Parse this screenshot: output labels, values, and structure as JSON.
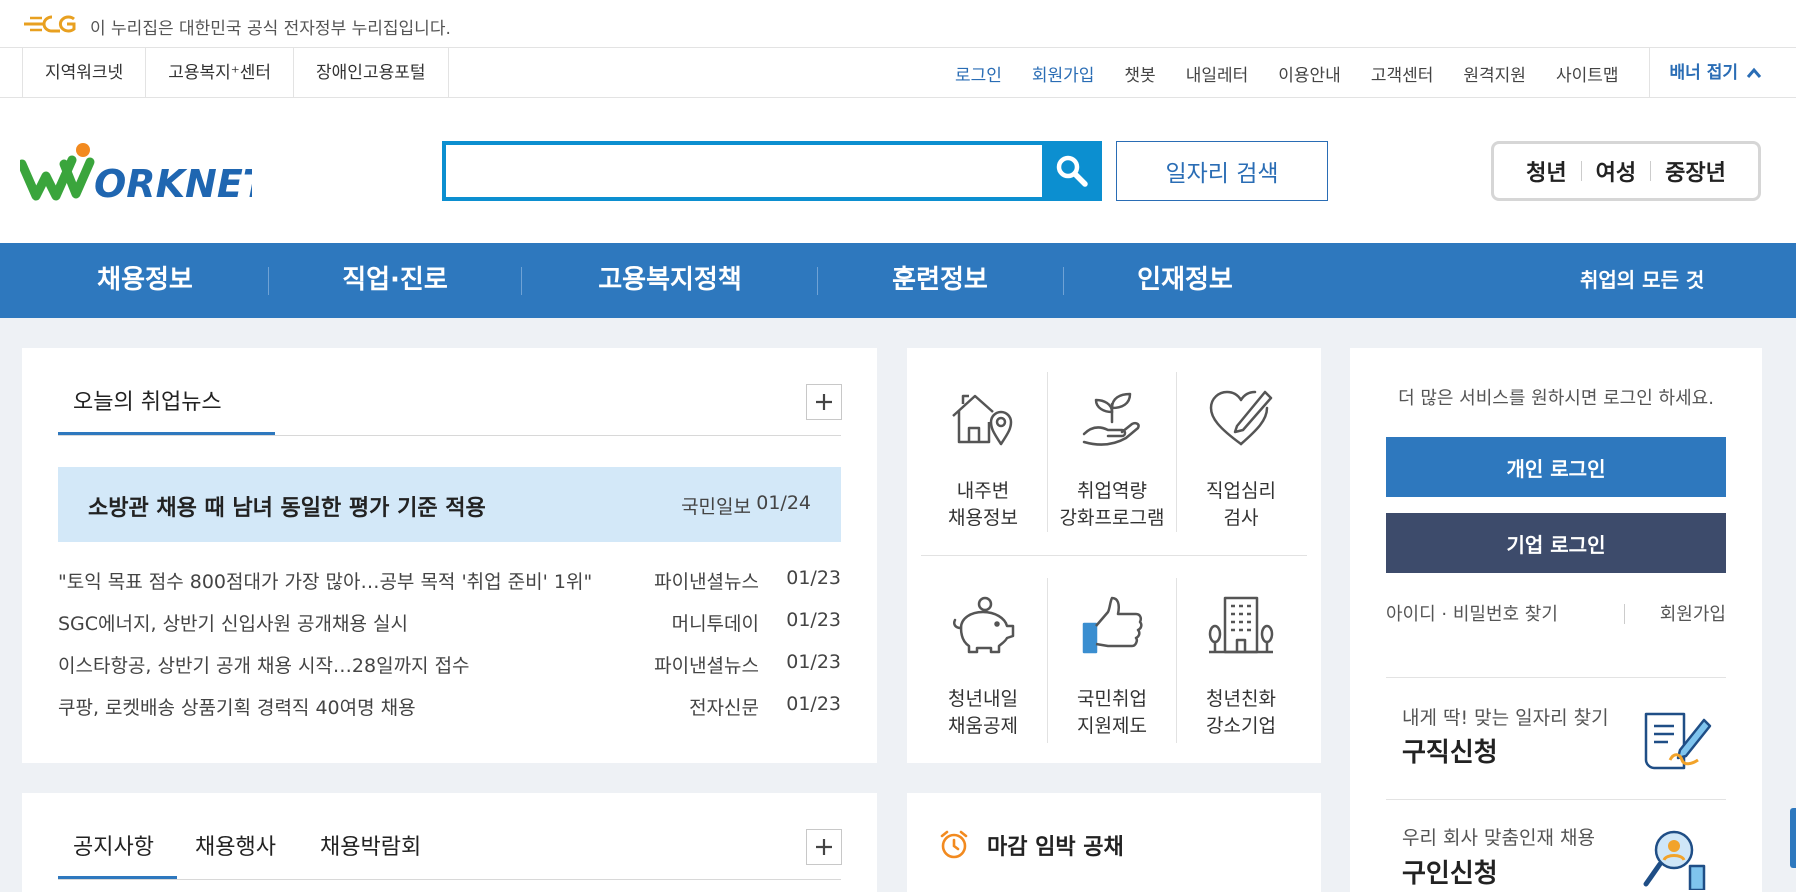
{
  "gov_banner": {
    "text": "이 누리집은 대한민국 공식 전자정부 누리집입니다."
  },
  "site_links": [
    "지역워크넷",
    "고용복지⁺센터",
    "장애인고용포털"
  ],
  "util_links": {
    "login": "로그인",
    "signup": "회원가입",
    "chatbot": "챗봇",
    "myletter": "내일레터",
    "guide": "이용안내",
    "support": "고객센터",
    "remote": "원격지원",
    "sitemap": "사이트맵",
    "fold": "배너 접기"
  },
  "header": {
    "search_placeholder": "",
    "job_search": "일자리 검색",
    "age_groups": [
      "청년",
      "여성",
      "중장년"
    ]
  },
  "gnb": {
    "menus": [
      "채용정보",
      "직업·진로",
      "고용복지정책",
      "훈련정보",
      "인재정보"
    ],
    "all": "취업의 모든 것"
  },
  "news": {
    "title": "오늘의 취업뉴스",
    "headline": {
      "title": "소방관 채용 때 남녀 동일한 평가 기준 적용",
      "source": "국민일보",
      "date": "01/24"
    },
    "items": [
      {
        "title": "\"토익 목표 점수 800점대가 가장 많아…공부 목적 '취업 준비' 1위\"",
        "source": "파이낸셜뉴스",
        "date": "01/23"
      },
      {
        "title": "SGC에너지, 상반기 신입사원 공개채용 실시",
        "source": "머니투데이",
        "date": "01/23"
      },
      {
        "title": "이스타항공, 상반기 공개 채용 시작…28일까지 접수",
        "source": "파이낸셜뉴스",
        "date": "01/23"
      },
      {
        "title": "쿠팡, 로켓배송 상품기획 경력직 40여명 채용",
        "source": "전자신문",
        "date": "01/23"
      }
    ]
  },
  "services": [
    {
      "line1": "내주변",
      "line2": "채용정보",
      "icon": "house-location-icon"
    },
    {
      "line1": "취업역량",
      "line2": "강화프로그램",
      "icon": "sprout-hand-icon"
    },
    {
      "line1": "직업심리",
      "line2": "검사",
      "icon": "heart-pen-icon"
    },
    {
      "line1": "청년내일",
      "line2": "채움공제",
      "icon": "piggy-bank-icon"
    },
    {
      "line1": "국민취업",
      "line2": "지원제도",
      "icon": "thumbs-up-icon"
    },
    {
      "line1": "청년친화",
      "line2": "강소기업",
      "icon": "building-icon"
    }
  ],
  "login": {
    "message": "더 많은 서비스를 원하시면 로그인 하세요.",
    "personal": "개인 로그인",
    "corporate": "기업 로그인",
    "find": "아이디 · 비밀번호 찾기",
    "join": "회원가입",
    "promo1": {
      "sub": "내게 딱! 맞는 일자리 찾기",
      "main": "구직신청"
    },
    "promo2": {
      "sub": "우리 회사 맞춤인재 채용",
      "main": "구인신청"
    }
  },
  "notice_tabs": [
    "공지사항",
    "채용행사",
    "채용박람회"
  ],
  "deadline": {
    "title": "마감 임박 공채"
  },
  "colors": {
    "primary": "#2e78be",
    "search": "#0c8fd0",
    "corporate": "#3d4b6b",
    "headline_bg": "#d3e8f8"
  }
}
